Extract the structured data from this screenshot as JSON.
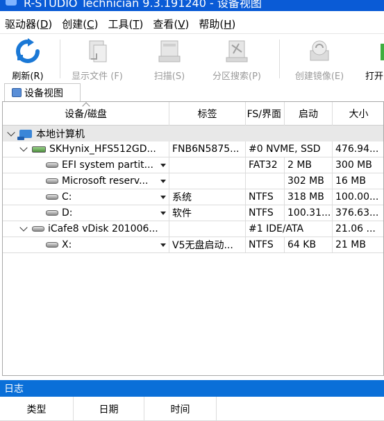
{
  "window": {
    "title": "R-STUDIO Technician 9.3.191240 - 设备视图"
  },
  "menu": [
    {
      "label": "驱动器",
      "key": "D"
    },
    {
      "label": "创建",
      "key": "C"
    },
    {
      "label": "工具",
      "key": "T"
    },
    {
      "label": "查看",
      "key": "V"
    },
    {
      "label": "帮助",
      "key": "H"
    }
  ],
  "toolbar": {
    "refresh": "刷新(R)",
    "show_files": "显示文件 (F)",
    "scan": "扫描(S)",
    "partition_search": "分区搜索(P)",
    "create_image": "创建镜像(E)",
    "open": "打开"
  },
  "tab": {
    "label": "设备视图"
  },
  "grid": {
    "columns": [
      "设备/磁盘",
      "标签",
      "FS/界面",
      "启动",
      "大小"
    ],
    "rows": [
      {
        "level": 0,
        "kind": "computer",
        "name": "本地计算机",
        "label": "",
        "fs": "",
        "start": "",
        "size": ""
      },
      {
        "level": 1,
        "kind": "disk",
        "name": "SKHynix_HFS512GD...",
        "label": "FNB6N5875...",
        "fs": "#0 NVME, SSD",
        "start": "",
        "size": "476.94..."
      },
      {
        "level": 2,
        "kind": "partition",
        "name": "EFI system partit...",
        "label": "",
        "fs": "FAT32",
        "start": "2 MB",
        "size": "300 MB"
      },
      {
        "level": 2,
        "kind": "partition",
        "name": "Microsoft reserv...",
        "label": "",
        "fs": "",
        "start": "302 MB",
        "size": "16 MB"
      },
      {
        "level": 2,
        "kind": "partition",
        "name": "C:",
        "label": "系统",
        "fs": "NTFS",
        "start": "318 MB",
        "size": "100.00..."
      },
      {
        "level": 2,
        "kind": "partition",
        "name": "D:",
        "label": "软件",
        "fs": "NTFS",
        "start": "100.31...",
        "size": "376.63..."
      },
      {
        "level": 1,
        "kind": "vdisk",
        "name": "iCafe8 vDisk 201006...",
        "label": "",
        "fs": "#1 IDE/ATA",
        "start": "",
        "size": "21.06 ..."
      },
      {
        "level": 2,
        "kind": "partition",
        "name": "X:",
        "label": "V5无盘启动...",
        "fs": "NTFS",
        "start": "64 KB",
        "size": "21 MB"
      }
    ]
  },
  "log": {
    "title": "日志",
    "columns": [
      "类型",
      "日期",
      "时间"
    ]
  }
}
